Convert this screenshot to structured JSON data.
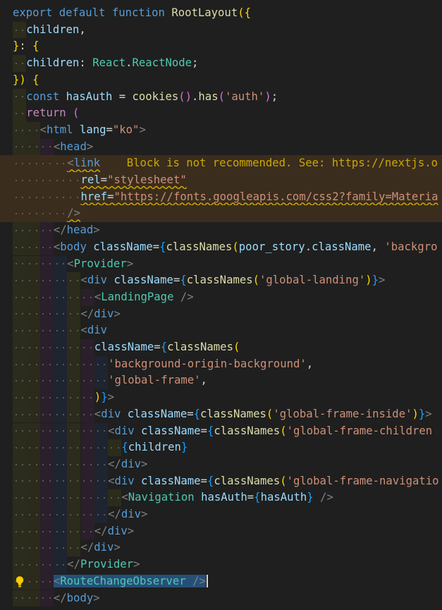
{
  "editor": {
    "language": "tsx",
    "warning_message": "Block is not recommended. See: https://nextjs.o",
    "lines": [
      [
        [
          "kw",
          "export "
        ],
        [
          "kw",
          "default "
        ],
        [
          "kw",
          "function "
        ],
        [
          "fn",
          "RootLayout"
        ],
        [
          "b1",
          "({"
        ]
      ],
      [
        [
          "var",
          "children"
        ],
        [
          "p",
          ","
        ]
      ],
      [
        [
          "b1",
          "}"
        ],
        [
          "p",
          ": "
        ],
        [
          "b1",
          "{"
        ]
      ],
      [
        [
          "var",
          "children"
        ],
        [
          "p",
          ": "
        ],
        [
          "ty",
          "React"
        ],
        [
          "p",
          "."
        ],
        [
          "ty",
          "ReactNode"
        ],
        [
          "p",
          ";"
        ]
      ],
      [
        [
          "b1",
          "})"
        ],
        [
          "p",
          " "
        ],
        [
          "b1",
          "{"
        ]
      ],
      [
        [
          "kw",
          "const "
        ],
        [
          "var",
          "hasAuth"
        ],
        [
          "p",
          " = "
        ],
        [
          "fn",
          "cookies"
        ],
        [
          "b2",
          "()"
        ],
        [
          "p",
          "."
        ],
        [
          "fn",
          "has"
        ],
        [
          "b2",
          "("
        ],
        [
          "str",
          "'auth'"
        ],
        [
          "b2",
          ")"
        ],
        [
          "p",
          ";"
        ]
      ],
      [
        [
          "kw2",
          "return "
        ],
        [
          "b2",
          "("
        ]
      ],
      [
        [
          "tag",
          "<"
        ],
        [
          "tn",
          "html"
        ],
        [
          "p",
          " "
        ],
        [
          "at",
          "lang"
        ],
        [
          "p",
          "="
        ],
        [
          "str",
          "\"ko\""
        ],
        [
          "tag",
          ">"
        ]
      ],
      [
        [
          "tag",
          "<"
        ],
        [
          "tn",
          "head"
        ],
        [
          "tag",
          ">"
        ]
      ],
      [
        [
          "tag",
          "<"
        ],
        [
          "tn",
          "link"
        ]
      ],
      [
        [
          "at",
          "rel"
        ],
        [
          "p",
          "="
        ],
        [
          "str",
          "\"stylesheet\""
        ]
      ],
      [
        [
          "at",
          "href"
        ],
        [
          "p",
          "="
        ],
        [
          "str",
          "\"https://fonts.googleapis.com/css2?family=Materia"
        ]
      ],
      [
        [
          "tag",
          "/>"
        ]
      ],
      [
        [
          "tag",
          "</"
        ],
        [
          "tn",
          "head"
        ],
        [
          "tag",
          ">"
        ]
      ],
      [
        [
          "tag",
          "<"
        ],
        [
          "tn",
          "body"
        ],
        [
          "p",
          " "
        ],
        [
          "at",
          "className"
        ],
        [
          "p",
          "="
        ],
        [
          "b3",
          "{"
        ],
        [
          "fn",
          "classNames"
        ],
        [
          "b1",
          "("
        ],
        [
          "var",
          "poor_story"
        ],
        [
          "p",
          "."
        ],
        [
          "var",
          "className"
        ],
        [
          "p",
          ", "
        ],
        [
          "str",
          "'backgro"
        ]
      ],
      [
        [
          "tag",
          "<"
        ],
        [
          "cmp",
          "Provider"
        ],
        [
          "tag",
          ">"
        ]
      ],
      [
        [
          "tag",
          "<"
        ],
        [
          "tn",
          "div"
        ],
        [
          "p",
          " "
        ],
        [
          "at",
          "className"
        ],
        [
          "p",
          "="
        ],
        [
          "b3",
          "{"
        ],
        [
          "fn",
          "classNames"
        ],
        [
          "b1",
          "("
        ],
        [
          "str",
          "'global-landing'"
        ],
        [
          "b1",
          ")"
        ],
        [
          "b3",
          "}"
        ],
        [
          "tag",
          ">"
        ]
      ],
      [
        [
          "tag",
          "<"
        ],
        [
          "cmp",
          "LandingPage"
        ],
        [
          "p",
          " "
        ],
        [
          "tag",
          "/>"
        ]
      ],
      [
        [
          "tag",
          "</"
        ],
        [
          "tn",
          "div"
        ],
        [
          "tag",
          ">"
        ]
      ],
      [
        [
          "tag",
          "<"
        ],
        [
          "tn",
          "div"
        ]
      ],
      [
        [
          "at",
          "className"
        ],
        [
          "p",
          "="
        ],
        [
          "b3",
          "{"
        ],
        [
          "fn",
          "classNames"
        ],
        [
          "b1",
          "("
        ]
      ],
      [
        [
          "str",
          "'background-origin-background'"
        ],
        [
          "p",
          ","
        ]
      ],
      [
        [
          "str",
          "'global-frame'"
        ],
        [
          "p",
          ","
        ]
      ],
      [
        [
          "b1",
          ")"
        ],
        [
          "b3",
          "}"
        ],
        [
          "tag",
          ">"
        ]
      ],
      [
        [
          "tag",
          "<"
        ],
        [
          "tn",
          "div"
        ],
        [
          "p",
          " "
        ],
        [
          "at",
          "className"
        ],
        [
          "p",
          "="
        ],
        [
          "b3",
          "{"
        ],
        [
          "fn",
          "classNames"
        ],
        [
          "b1",
          "("
        ],
        [
          "str",
          "'global-frame-inside'"
        ],
        [
          "b1",
          ")"
        ],
        [
          "b3",
          "}"
        ],
        [
          "tag",
          ">"
        ]
      ],
      [
        [
          "tag",
          "<"
        ],
        [
          "tn",
          "div"
        ],
        [
          "p",
          " "
        ],
        [
          "at",
          "className"
        ],
        [
          "p",
          "="
        ],
        [
          "b3",
          "{"
        ],
        [
          "fn",
          "classNames"
        ],
        [
          "b1",
          "("
        ],
        [
          "str",
          "'global-frame-children"
        ]
      ],
      [
        [
          "b3",
          "{"
        ],
        [
          "var",
          "children"
        ],
        [
          "b3",
          "}"
        ]
      ],
      [
        [
          "tag",
          "</"
        ],
        [
          "tn",
          "div"
        ],
        [
          "tag",
          ">"
        ]
      ],
      [
        [
          "tag",
          "<"
        ],
        [
          "tn",
          "div"
        ],
        [
          "p",
          " "
        ],
        [
          "at",
          "className"
        ],
        [
          "p",
          "="
        ],
        [
          "b3",
          "{"
        ],
        [
          "fn",
          "classNames"
        ],
        [
          "b1",
          "("
        ],
        [
          "str",
          "'global-frame-navigatio"
        ]
      ],
      [
        [
          "tag",
          "<"
        ],
        [
          "cmp",
          "Navigation"
        ],
        [
          "p",
          " "
        ],
        [
          "at",
          "hasAuth"
        ],
        [
          "p",
          "="
        ],
        [
          "b3",
          "{"
        ],
        [
          "var",
          "hasAuth"
        ],
        [
          "b3",
          "}"
        ],
        [
          "p",
          " "
        ],
        [
          "tag",
          "/>"
        ]
      ],
      [
        [
          "tag",
          "</"
        ],
        [
          "tn",
          "div"
        ],
        [
          "tag",
          ">"
        ]
      ],
      [
        [
          "tag",
          "</"
        ],
        [
          "tn",
          "div"
        ],
        [
          "tag",
          ">"
        ]
      ],
      [
        [
          "tag",
          "</"
        ],
        [
          "tn",
          "div"
        ],
        [
          "tag",
          ">"
        ]
      ],
      [
        [
          "tag",
          "</"
        ],
        [
          "cmp",
          "Provider"
        ],
        [
          "tag",
          ">"
        ]
      ],
      [
        [
          "tag",
          "<"
        ],
        [
          "cmp",
          "RouteChangeObserver"
        ],
        [
          "p",
          " "
        ],
        [
          "tag",
          "/>"
        ]
      ],
      [
        [
          "tag",
          "</"
        ],
        [
          "tn",
          "body"
        ],
        [
          "tag",
          ">"
        ]
      ]
    ],
    "indents": [
      0,
      1,
      0,
      1,
      0,
      1,
      1,
      2,
      3,
      4,
      5,
      5,
      4,
      3,
      3,
      4,
      5,
      6,
      5,
      5,
      6,
      7,
      7,
      6,
      6,
      7,
      8,
      7,
      7,
      8,
      7,
      6,
      5,
      4,
      3,
      3
    ],
    "warning_lines": [
      9,
      10,
      11,
      12
    ],
    "selected_line": 34,
    "lightbulb_line": 34,
    "colors": {
      "background": "#1f1f1f",
      "warning": "#cca700",
      "selection": "#264f78",
      "guide_bands": [
        "#2b2c1c",
        "#2c2a1c",
        "#2a1f2a",
        "#1e2430",
        "#2b2c1c",
        "#2a1f2a",
        "#1e2430",
        "#2b2c1c"
      ]
    }
  }
}
